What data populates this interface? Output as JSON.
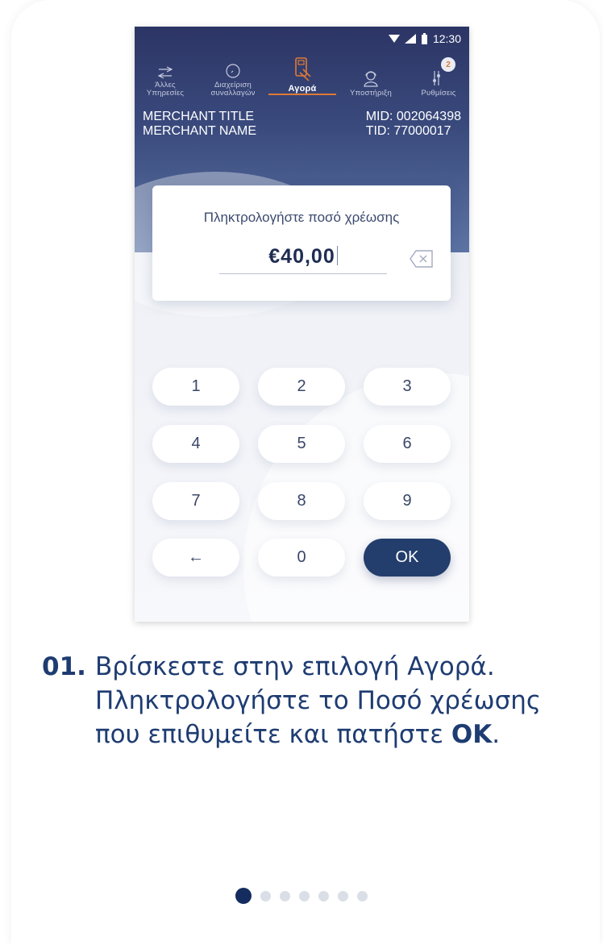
{
  "status_bar": {
    "time": "12:30"
  },
  "tabs": [
    {
      "label": "Άλλες Υπηρεσίες",
      "icon": "arrows-exchange-icon"
    },
    {
      "label": "Διαχείριση συναλλαγών",
      "icon": "clock-icon"
    },
    {
      "label": "Αγορά",
      "icon": "card-pos-icon",
      "active": true
    },
    {
      "label": "Υποστήριξη",
      "icon": "support-agent-icon"
    },
    {
      "label": "Ρυθμίσεις",
      "icon": "sliders-icon",
      "badge": "2"
    }
  ],
  "merchant": {
    "title": "MERCHANT TITLE",
    "name": "MERCHANT NAME",
    "mid": "MID: 002064398",
    "tid": "TID: 77000017"
  },
  "amount": {
    "label": "Πληκτρολογήστε ποσό χρέωσης",
    "value": "€40,00"
  },
  "keypad": {
    "k1": "1",
    "k2": "2",
    "k3": "3",
    "k4": "4",
    "k5": "5",
    "k6": "6",
    "k7": "7",
    "k8": "8",
    "k9": "9",
    "back": "←",
    "k0": "0",
    "ok": "OK"
  },
  "caption": {
    "number": "01.",
    "line1": "Βρίσκεστε στην επιλογή Αγορά.",
    "line2": "Πληκτρολογήστε το Ποσό χρέωσης",
    "line3_pre": "που επιθυμείτε και πατήστε ",
    "line3_bold": "OK",
    "line3_post": "."
  },
  "pagination": {
    "total": 7,
    "active_index": 0
  },
  "colors": {
    "accent": "#e07a35",
    "primary": "#233e6c",
    "caption": "#1e3c72"
  }
}
